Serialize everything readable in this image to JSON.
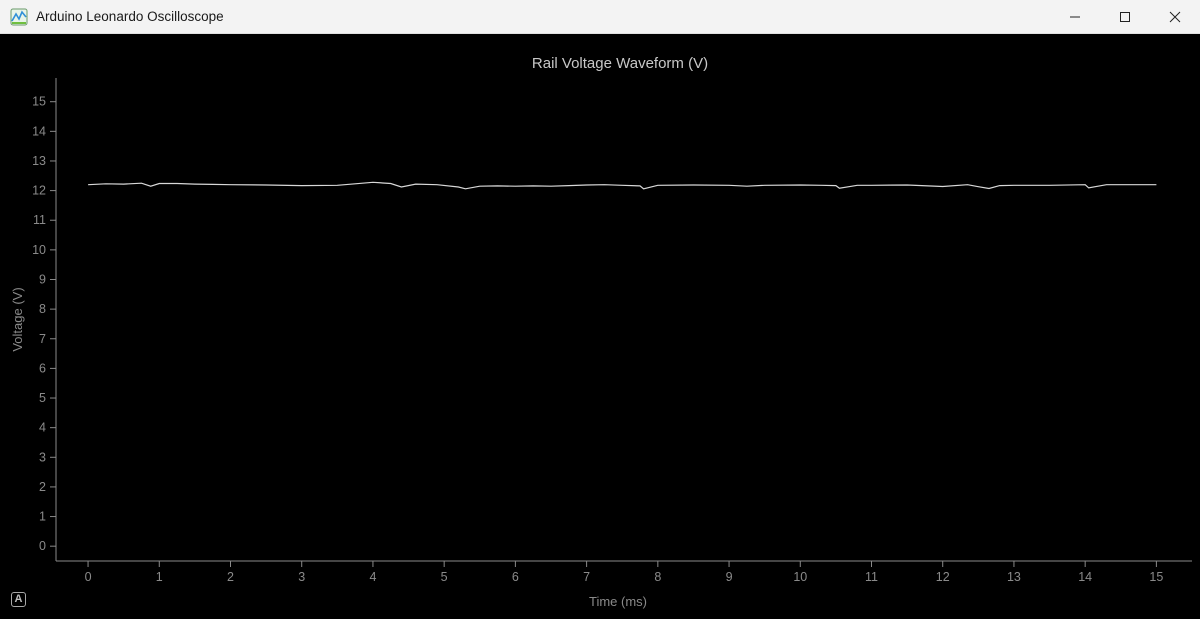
{
  "window": {
    "title": "Arduino Leonardo Oscilloscope"
  },
  "auto_button_label": "A",
  "colors": {
    "background": "#000000",
    "axis": "#8a8a8a",
    "trace": "#d8d8d8",
    "title": "#c8c8c8"
  },
  "chart_data": {
    "type": "line",
    "title": "Rail Voltage Waveform (V)",
    "xlabel": "Time (ms)",
    "ylabel": "Voltage (V)",
    "xlim": [
      -0.45,
      15.5
    ],
    "ylim": [
      -0.5,
      15.8
    ],
    "xticks": [
      0,
      1,
      2,
      3,
      4,
      5,
      6,
      7,
      8,
      9,
      10,
      11,
      12,
      13,
      14,
      15
    ],
    "yticks": [
      0,
      1,
      2,
      3,
      4,
      5,
      6,
      7,
      8,
      9,
      10,
      11,
      12,
      13,
      14,
      15
    ],
    "grid": false,
    "series": [
      {
        "x": [
          0,
          0.25,
          0.5,
          0.75,
          0.88,
          1.0,
          1.25,
          1.5,
          1.75,
          2.0,
          2.5,
          3.0,
          3.5,
          3.75,
          4.0,
          4.25,
          4.4,
          4.6,
          4.9,
          5.2,
          5.3,
          5.5,
          5.75,
          6.0,
          6.25,
          6.5,
          6.75,
          7.0,
          7.25,
          7.5,
          7.75,
          7.8,
          8.0,
          8.5,
          9.0,
          9.25,
          9.5,
          10.0,
          10.3,
          10.5,
          10.55,
          10.8,
          11.0,
          11.5,
          12.0,
          12.35,
          12.5,
          12.65,
          12.8,
          13.0,
          13.5,
          14.0,
          14.05,
          14.3,
          14.6,
          15.0
        ],
        "y": [
          12.2,
          12.23,
          12.22,
          12.25,
          12.15,
          12.24,
          12.24,
          12.22,
          12.21,
          12.2,
          12.19,
          12.17,
          12.18,
          12.23,
          12.28,
          12.24,
          12.12,
          12.22,
          12.2,
          12.12,
          12.06,
          12.15,
          12.16,
          12.15,
          12.16,
          12.15,
          12.17,
          12.19,
          12.2,
          12.18,
          12.16,
          12.06,
          12.18,
          12.19,
          12.18,
          12.15,
          12.18,
          12.19,
          12.18,
          12.17,
          12.08,
          12.18,
          12.18,
          12.19,
          12.14,
          12.2,
          12.13,
          12.07,
          12.17,
          12.18,
          12.18,
          12.2,
          12.09,
          12.2,
          12.2,
          12.2
        ]
      }
    ]
  }
}
